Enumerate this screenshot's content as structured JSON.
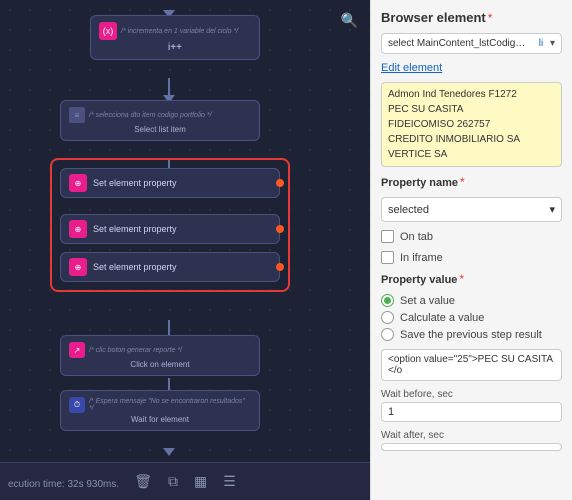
{
  "canvas": {
    "execution_time": "ecution time: 32s 930ms.",
    "search_icon": "🔍",
    "nodes": {
      "increment": {
        "comment": "/* incrementa en 1 variable del ciclo */",
        "line1": "i++",
        "icon": "(x)"
      },
      "select_list": {
        "comment": "/* selecciona dto item codigo portfolio */",
        "label": "Select list item"
      },
      "set_prop_1": {
        "label": "Set element property"
      },
      "set_prop_2": {
        "label": "Set element property"
      },
      "set_prop_3": {
        "label": "Set element property"
      },
      "click": {
        "comment": "/* clic boton generar reporte */",
        "label": "Click on element"
      },
      "wait": {
        "comment": "/* Espera mensaje \"No se encontraron resultados\" */",
        "label": "Wait for element"
      }
    },
    "toolbar": {
      "delete": "🗑",
      "copy": "⧉",
      "group": "▦",
      "settings": "☰"
    }
  },
  "right_panel": {
    "title": "Browser element",
    "title_asterisk": "*",
    "select_value": "select MainContent_lstCodigo_Port",
    "select_suffix": "li",
    "edit_link": "Edit element",
    "list_items": [
      "Admon Ind Tenedores F1272",
      "PEC SU CASITA",
      "FIDEICOMISO 262757",
      "CREDITO INMOBILIARIO SA",
      "VERTICE SA"
    ],
    "property_name_label": "Property name",
    "property_name_asterisk": "*",
    "property_name_value": "selected",
    "property_name_chevron": "▾",
    "checkbox_on_tab": "On tab",
    "checkbox_in_iframe": "In iframe",
    "property_value_label": "Property value",
    "property_value_asterisk": "*",
    "radio_options": [
      {
        "label": "Set a value",
        "selected": true
      },
      {
        "label": "Calculate a value",
        "selected": false
      },
      {
        "label": "Save the previous step result",
        "selected": false
      }
    ],
    "value_text": "<option value=\"25\">PEC SU CASITA</o",
    "wait_before_label": "Wait before, sec",
    "wait_before_value": "1",
    "wait_after_label": "Wait after, sec"
  }
}
